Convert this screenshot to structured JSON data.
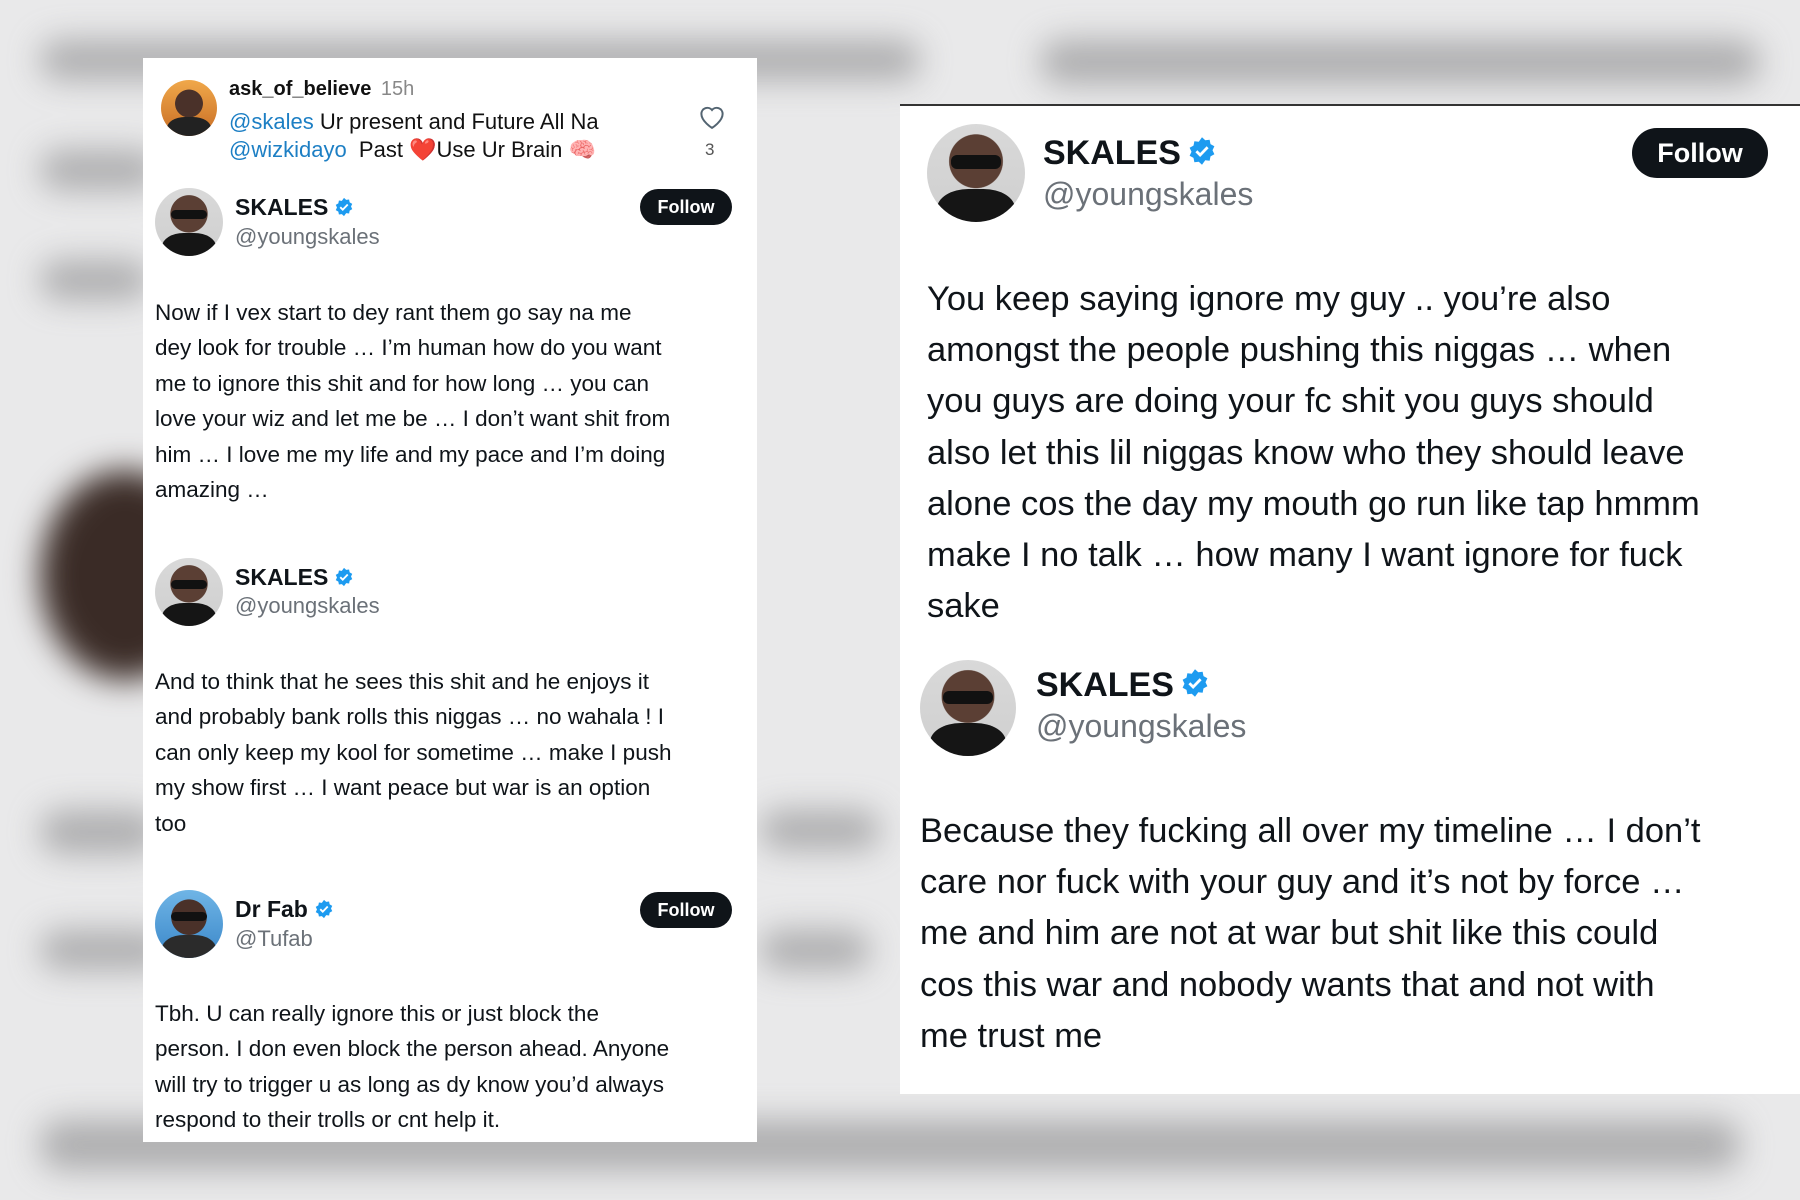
{
  "comment": {
    "username": "ask_of_believe",
    "time": "15h",
    "line1_mention": "@skales",
    "line1_text": " Ur present and Future All Na",
    "line2_mention": "@wizkidayo",
    "line2_text": "  Past ",
    "heart_emoji": "❤️",
    "line2_text2": "Use Ur Brain ",
    "brain_emoji": "🧠",
    "like_count": "3"
  },
  "left_tweets": [
    {
      "name": "SKALES",
      "handle": "@youngskales",
      "follow_label": "Follow",
      "text": "Now if I vex start to dey rant them go say na me\ndey look for trouble … I’m human how do you want\nme to ignore this shit and for how long … you can\nlove your wiz and let me be … I don’t want shit from\nhim … I love me my life and my pace and I’m doing\namazing …"
    },
    {
      "name": "SKALES",
      "handle": "@youngskales",
      "text": "And to think that he sees this shit and he enjoys it\nand probably bank rolls this niggas … no wahala ! I\ncan only keep my kool for sometime … make I push\nmy show first … I want peace but war is an option\ntoo"
    },
    {
      "name": "Dr Fab",
      "handle": "@Tufab",
      "follow_label": "Follow",
      "text": "Tbh. U can really ignore this or just block the\nperson. I don even block the person ahead. Anyone\nwill try to trigger u as long as dy know you’d always\nrespond to their trolls or cnt help it."
    }
  ],
  "right_tweets": [
    {
      "name": "SKALES",
      "handle": "@youngskales",
      "follow_label": "Follow",
      "text": "You keep saying ignore my guy .. you’re also\namongst the people pushing this niggas … when\nyou guys are doing your fc shit you guys should\nalso let this lil niggas know who they should leave\nalone cos the day my mouth go run like tap hmmm\nmake I no talk … how many I want ignore for fuck\nsake"
    },
    {
      "name": "SKALES",
      "handle": "@youngskales",
      "text": "Because they fucking all over my timeline … I don’t\ncare nor fuck with your guy and it’s not by force …\nme and him are not at war but shit like this could\ncos this war and nobody wants that and not with\nme trust me"
    }
  ],
  "colors": {
    "verified": "#1d9bf0",
    "mention": "#1d7fc4",
    "follow_bg": "#0f1419",
    "heart_outline": "#536471"
  }
}
